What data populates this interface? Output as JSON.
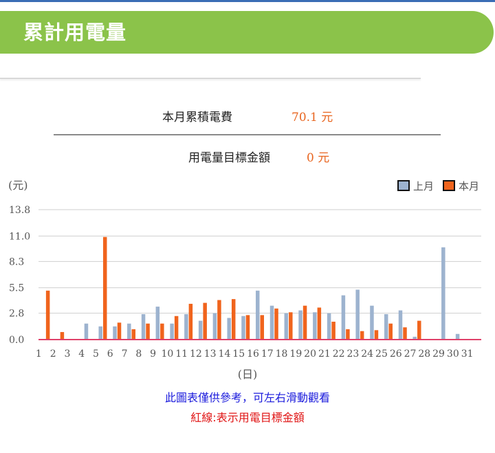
{
  "header": {
    "title": "累計用電量"
  },
  "summary": {
    "monthly_cost_label": "本月累積電費",
    "monthly_cost_value": "70.1 元",
    "target_label": "用電量目標金額",
    "target_value": "0 元"
  },
  "notes": {
    "reference": "此圖表僅供參考，可左右滑動觀看",
    "red_line": "紅線:表示用電目標金額"
  },
  "colors": {
    "last_month": "#9db3cf",
    "this_month": "#f0641d",
    "target_line": "#e0406a"
  },
  "chart_data": {
    "type": "bar",
    "ylabel": "(元)",
    "xlabel": "(日)",
    "ylim": [
      0,
      13.8
    ],
    "y_ticks": [
      0.0,
      2.8,
      5.5,
      8.3,
      11.0,
      13.8
    ],
    "y_tick_labels": [
      "0.0",
      "2.8",
      "5.5",
      "8.3",
      "11.0",
      "13.8"
    ],
    "grid": true,
    "legend": "top-right",
    "target_value": 0,
    "categories": [
      "1",
      "2",
      "3",
      "4",
      "5",
      "6",
      "7",
      "8",
      "9",
      "10",
      "11",
      "12",
      "13",
      "14",
      "15",
      "16",
      "17",
      "18",
      "19",
      "20",
      "21",
      "22",
      "23",
      "24",
      "25",
      "26",
      "27",
      "28",
      "29",
      "30",
      "31"
    ],
    "series": [
      {
        "name": "上月",
        "color": "#9db3cf",
        "values": [
          0,
          0,
          0,
          1.7,
          1.4,
          1.4,
          1.7,
          2.7,
          3.5,
          1.7,
          2.7,
          2.0,
          2.8,
          2.3,
          2.5,
          5.2,
          3.6,
          2.8,
          3.1,
          2.9,
          2.8,
          4.7,
          5.3,
          3.6,
          2.7,
          3.1,
          0.3,
          0,
          9.8,
          0.6,
          0
        ]
      },
      {
        "name": "本月",
        "color": "#f0641d",
        "values": [
          5.2,
          0.8,
          0,
          0,
          10.9,
          1.8,
          1.1,
          1.7,
          1.7,
          2.5,
          3.8,
          3.9,
          4.2,
          4.3,
          2.6,
          2.6,
          3.3,
          2.9,
          3.6,
          3.4,
          1.9,
          1.1,
          0.9,
          1.0,
          1.7,
          1.3,
          2.0,
          0,
          0,
          0,
          0
        ]
      }
    ]
  }
}
